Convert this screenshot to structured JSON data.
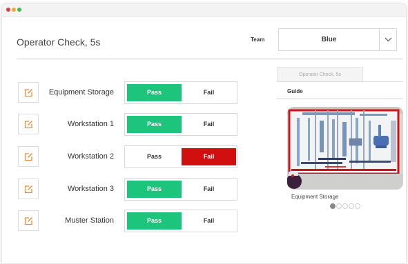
{
  "header": {
    "title": "Operator Check, 5s",
    "team_label": "Team",
    "team_value": "Blue"
  },
  "checks": [
    {
      "label": "Equipment Storage",
      "pass_label": "Pass",
      "fail_label": "Fail",
      "status": "pass"
    },
    {
      "label": "Workstation 1",
      "pass_label": "Pass",
      "fail_label": "Fail",
      "status": "pass"
    },
    {
      "label": "Workstation 2",
      "pass_label": "Pass",
      "fail_label": "Fail",
      "status": "fail"
    },
    {
      "label": "Workstation 3",
      "pass_label": "Pass",
      "fail_label": "Fail",
      "status": "pass"
    },
    {
      "label": "Muster Station",
      "pass_label": "Pass",
      "fail_label": "Fail",
      "status": "pass"
    }
  ],
  "guide": {
    "tab_label": "Operator Check, 5s",
    "heading": "Guide",
    "caption": "Equipment Storage",
    "carousel_count": 5,
    "carousel_active": 1
  },
  "icons": {
    "window_controls": [
      "close-dot",
      "minimize-dot",
      "maximize-dot"
    ],
    "row_action": "edit-icon",
    "dropdown": "chevron-down-icon"
  },
  "colors": {
    "pass_active": "#1dc47b",
    "fail_active": "#d10f0f",
    "edit_icon": "#f08a36",
    "control_close": "#d9433b",
    "control_minimize": "#f0a92c",
    "control_maximize": "#35c24a"
  }
}
